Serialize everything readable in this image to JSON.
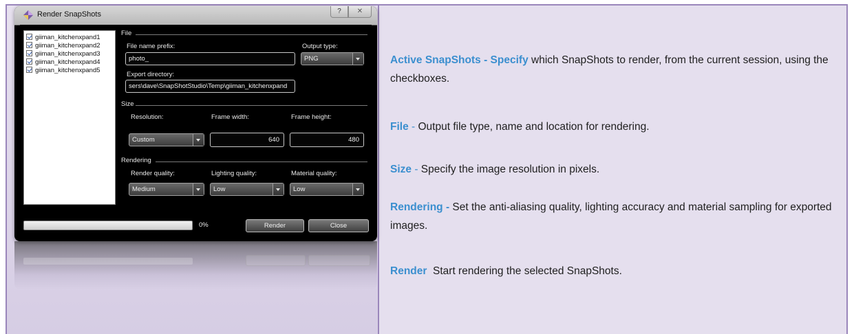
{
  "dialog": {
    "title": "Render SnapShots",
    "help_btn": "?",
    "close_btn": "✕",
    "snapshots": [
      {
        "label": "giiman_kitchenxpand1",
        "checked": true
      },
      {
        "label": "giiman_kitchenxpand2",
        "checked": true
      },
      {
        "label": "giiman_kitchenxpand3",
        "checked": true
      },
      {
        "label": "giiman_kitchenxpand4",
        "checked": true
      },
      {
        "label": "giiman_kitchenxpand5",
        "checked": true
      }
    ],
    "file_section": "File",
    "file_prefix_label": "File name prefix:",
    "file_prefix_value": "photo_",
    "output_type_label": "Output type:",
    "output_type_value": "PNG",
    "export_dir_label": "Export directory:",
    "export_dir_value": "sers\\dave\\SnapShotStudio\\Temp\\giiman_kitchenxpand",
    "size_section": "Size",
    "resolution_label": "Resolution:",
    "resolution_value": "Custom",
    "frame_width_label": "Frame width:",
    "frame_width_value": "640",
    "frame_height_label": "Frame height:",
    "frame_height_value": "480",
    "rendering_section": "Rendering",
    "render_quality_label": "Render quality:",
    "render_quality_value": "Medium",
    "lighting_quality_label": "Lighting quality:",
    "lighting_quality_value": "Low",
    "material_quality_label": "Material quality:",
    "material_quality_value": "Low",
    "progress_value": 0,
    "progress_text": "0%",
    "render_btn": "Render",
    "close_dialog_btn": "Close"
  },
  "descriptions": [
    {
      "heading": "Active SnapShots - Specify",
      "sep": "",
      "text": " which SnapShots to render, from the current session, using the checkboxes."
    },
    {
      "heading": "File",
      "sep": " - ",
      "text": "Output file type, name and location for rendering."
    },
    {
      "heading": "Size",
      "sep": " - ",
      "text": "Specify the image resolution in pixels."
    },
    {
      "heading": "Rendering -",
      "sep": "",
      "text": " Set the anti-aliasing quality, lighting accuracy and material sampling for exported images."
    },
    {
      "heading": "Render",
      "sep": "",
      "text": "  Start rendering the selected SnapShots."
    }
  ],
  "colors": {
    "accent": "#3b8fcf",
    "frame": "#9a86bb",
    "panel_bg": "#e5dfee"
  },
  "icons": {
    "title": "snapshot-app-icon",
    "dropdown": "chevron-down-icon",
    "check": "check-icon"
  }
}
